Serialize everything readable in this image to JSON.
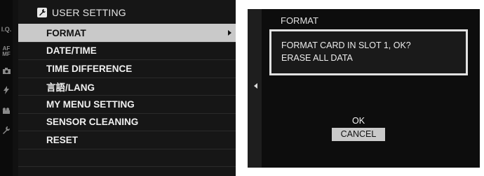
{
  "menu": {
    "title": "USER SETTING",
    "items": [
      {
        "label": "FORMAT",
        "selected": true
      },
      {
        "label": "DATE/TIME",
        "selected": false
      },
      {
        "label": "TIME DIFFERENCE",
        "selected": false
      },
      {
        "label": "言語/LANG",
        "selected": false
      },
      {
        "label": "MY MENU SETTING",
        "selected": false
      },
      {
        "label": "SENSOR CLEANING",
        "selected": false
      },
      {
        "label": "RESET",
        "selected": false
      }
    ]
  },
  "side_tabs": {
    "iq": "I.Q.",
    "af_top": "AF",
    "af_bottom": "MF",
    "icons": [
      "camera-icon",
      "flash-icon",
      "movie-icon",
      "wrench-icon"
    ]
  },
  "dialog": {
    "title": "FORMAT",
    "message_line1": "FORMAT CARD IN SLOT 1, OK?",
    "message_line2": "ERASE ALL DATA",
    "ok_label": "OK",
    "cancel_label": "CANCEL",
    "selected_option": "CANCEL"
  },
  "colors": {
    "highlight": "#c9c9c9",
    "background": "#111111",
    "text": "#f0f0f0"
  }
}
